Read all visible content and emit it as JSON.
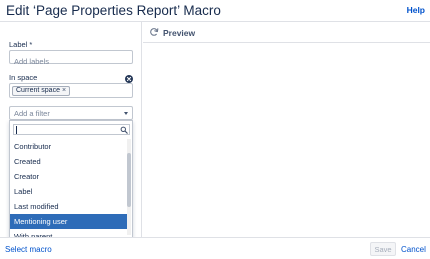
{
  "dialog": {
    "title": "Edit ‘Page Properties Report’ Macro",
    "help_label": "Help"
  },
  "form": {
    "label_field": {
      "label": "Label *",
      "placeholder": "Add labels",
      "value": ""
    },
    "space_field": {
      "label": "In space",
      "chip": "Current space",
      "chip_remove": "×"
    },
    "filter_field": {
      "placeholder": "Add a filter",
      "search_value": "",
      "options": [
        {
          "label": "Contributor",
          "selected": false
        },
        {
          "label": "Created",
          "selected": false
        },
        {
          "label": "Creator",
          "selected": false
        },
        {
          "label": "Label",
          "selected": false
        },
        {
          "label": "Last modified",
          "selected": false
        },
        {
          "label": "Mentioning user",
          "selected": true
        },
        {
          "label": "With parent",
          "selected": false
        }
      ]
    }
  },
  "preview": {
    "label": "Preview"
  },
  "footer": {
    "select_macro": "Select macro",
    "save": "Save",
    "cancel": "Cancel"
  },
  "colors": {
    "link": "#0052cc",
    "selected": "#2e6cb8",
    "border": "#c1c7d0"
  }
}
